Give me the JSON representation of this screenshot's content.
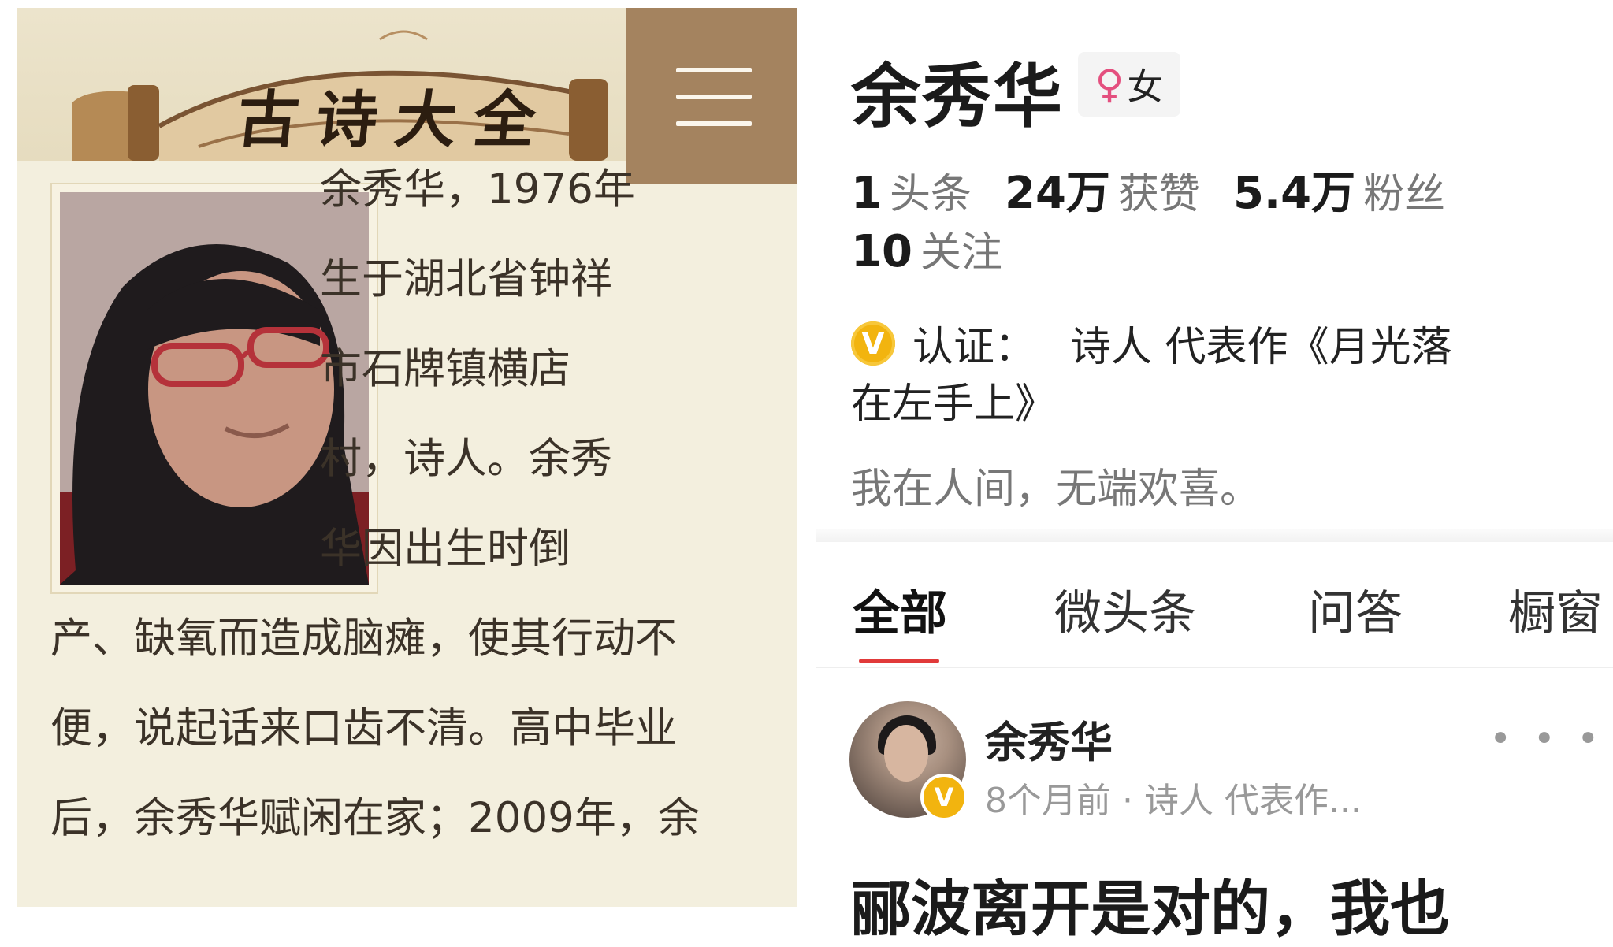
{
  "left_panel": {
    "banner_title": "古诗大全",
    "menu_icon": "hamburger-menu-icon",
    "author_photo_alt": "余秀华",
    "bio_lines": [
      "余秀华，1976年",
      "生于湖北省钟祥",
      "市石牌镇横店",
      "村，诗人。余秀",
      "华因出生时倒",
      "产、缺氧而造成脑瘫，使其行动不",
      "便，说起话来口齿不清。高中毕业",
      "后，余秀华赋闲在家；2009年，余"
    ]
  },
  "profile": {
    "name": "余秀华",
    "gender_icon": "female-symbol-icon",
    "gender_symbol": "♀",
    "gender": "女",
    "stats": [
      {
        "value": "1",
        "label": "头条"
      },
      {
        "value": "24万",
        "label": "获赞"
      },
      {
        "value": "5.4万",
        "label": "粉丝"
      }
    ],
    "following": {
      "value": "10",
      "label": "关注"
    },
    "verification": {
      "icon": "verified-v-icon",
      "badge_letter": "V",
      "label": "认证：",
      "text_line1": "诗人 代表作《月光落",
      "text_line2": "在左手上》"
    },
    "signature": "我在人间，无端欢喜。"
  },
  "tabs": [
    {
      "label": "全部",
      "active": true
    },
    {
      "label": "微头条",
      "active": false
    },
    {
      "label": "问答",
      "active": false
    },
    {
      "label": "橱窗",
      "active": false
    }
  ],
  "post": {
    "author": "余秀华",
    "meta": "8个月前 · 诗人 代表作...",
    "verify_letter": "V",
    "more_icon": "more-dots-icon",
    "more_label": "• • •",
    "headline": "郦波离开是对的，我也"
  },
  "colors": {
    "left_bg": "#f3efde",
    "menu_bg": "#a4835f",
    "accent_red": "#e13a3a",
    "verify_gold": "#f2b40f",
    "gender_pink": "#e4507f"
  }
}
